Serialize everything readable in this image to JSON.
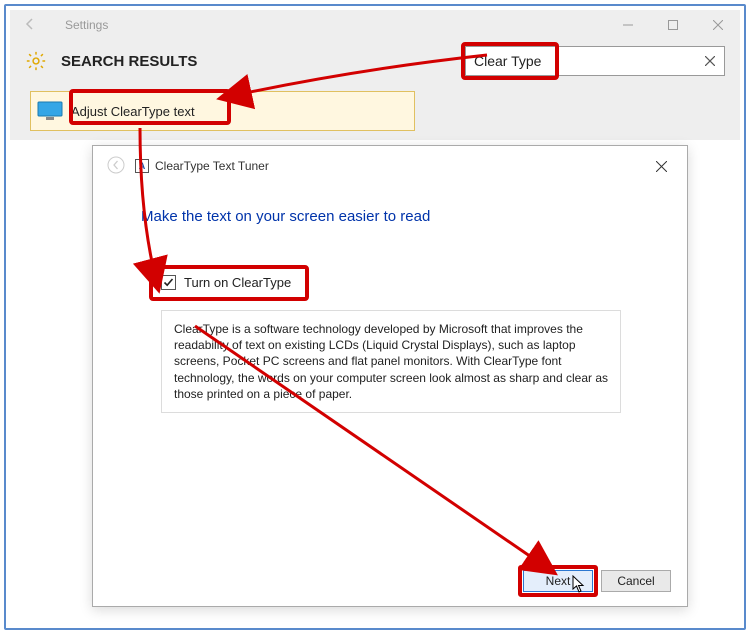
{
  "settings": {
    "title": "Settings",
    "header": "SEARCH RESULTS",
    "search_value": "Clear Type",
    "result_label": "Adjust ClearType text"
  },
  "dialog": {
    "title": "ClearType Text Tuner",
    "heading": "Make the text on your screen easier to read",
    "checkbox_label": "Turn on ClearType",
    "checkbox_checked": true,
    "description": "ClearType is a software technology developed by Microsoft that improves the readability of text on existing LCDs (Liquid Crystal Displays), such as laptop screens, Pocket PC screens and flat panel monitors. With ClearType font technology, the words on your computer screen look almost as sharp and clear as those printed on a piece of paper.",
    "next_label": "Next",
    "cancel_label": "Cancel"
  }
}
